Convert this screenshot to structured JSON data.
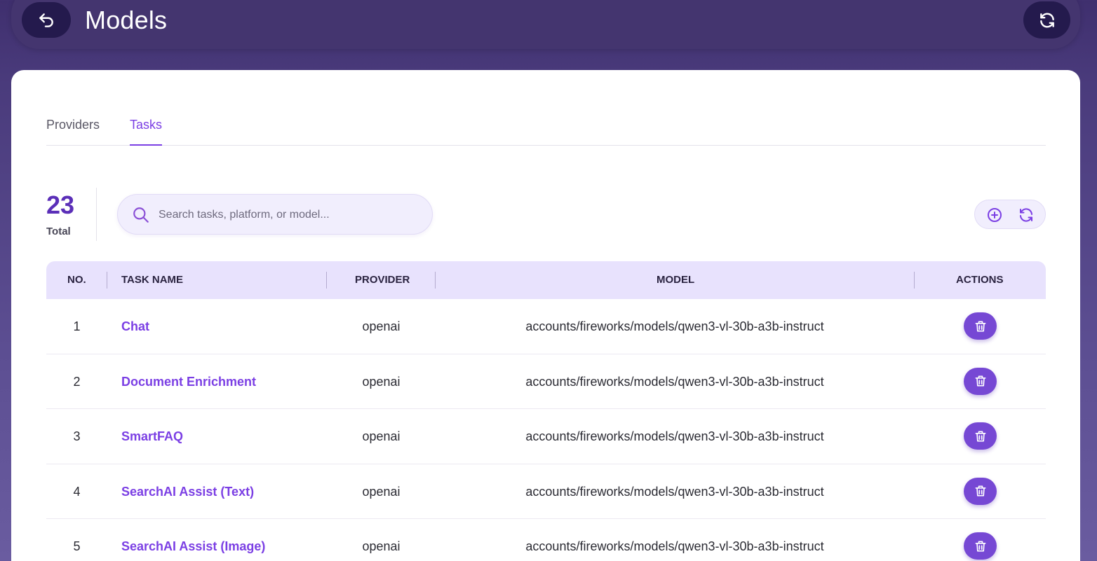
{
  "header": {
    "title": "Models",
    "back_icon": "back-arrow-icon",
    "refresh_icon": "refresh-icon"
  },
  "tabs": [
    {
      "label": "Providers",
      "active": false
    },
    {
      "label": "Tasks",
      "active": true
    }
  ],
  "summary": {
    "total_count": "23",
    "total_label": "Total"
  },
  "search": {
    "placeholder": "Search tasks, platform, or model...",
    "value": ""
  },
  "table": {
    "columns": [
      "NO.",
      "TASK NAME",
      "PROVIDER",
      "MODEL",
      "ACTIONS"
    ],
    "rows": [
      {
        "no": "1",
        "task_name": "Chat",
        "provider": "openai",
        "model": "accounts/fireworks/models/qwen3-vl-30b-a3b-instruct"
      },
      {
        "no": "2",
        "task_name": "Document Enrichment",
        "provider": "openai",
        "model": "accounts/fireworks/models/qwen3-vl-30b-a3b-instruct"
      },
      {
        "no": "3",
        "task_name": "SmartFAQ",
        "provider": "openai",
        "model": "accounts/fireworks/models/qwen3-vl-30b-a3b-instruct"
      },
      {
        "no": "4",
        "task_name": "SearchAI Assist (Text)",
        "provider": "openai",
        "model": "accounts/fireworks/models/qwen3-vl-30b-a3b-instruct"
      },
      {
        "no": "5",
        "task_name": "SearchAI Assist (Image)",
        "provider": "openai",
        "model": "accounts/fireworks/models/qwen3-vl-30b-a3b-instruct"
      }
    ]
  },
  "colors": {
    "accent": "#7b3fe4",
    "header_bg": "#44356f",
    "dark_button": "#241a4d",
    "delete_button": "#7648d4",
    "table_header_bg": "#e8e2fd"
  }
}
